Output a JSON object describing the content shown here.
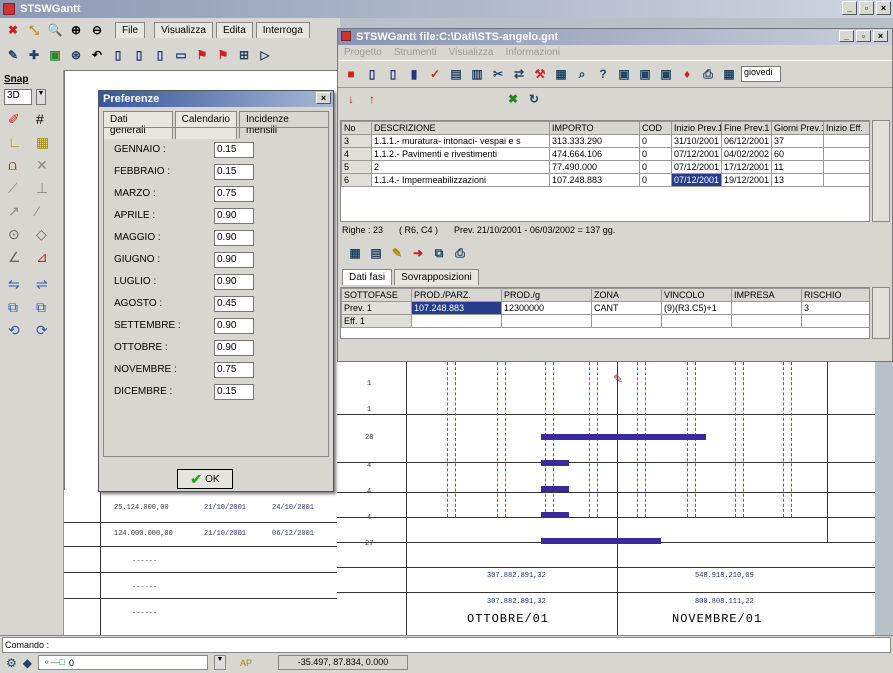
{
  "main_window": {
    "title": "STSWGantt"
  },
  "left_menu": {
    "file": "File",
    "visualizza": "Visualizza",
    "edita": "Edita",
    "interroga": "Interroga"
  },
  "snap": {
    "label": "Snap",
    "dim": "3D"
  },
  "preferences": {
    "title": "Preferenze",
    "tabs": [
      "Dati generali",
      "Calendario",
      "Incidenze mensili"
    ],
    "months": [
      {
        "name": "GENNAIO :",
        "value": "0.15"
      },
      {
        "name": "FEBBRAIO :",
        "value": "0.15"
      },
      {
        "name": "MARZO :",
        "value": "0.75"
      },
      {
        "name": "APRILE :",
        "value": "0.90"
      },
      {
        "name": "MAGGIO :",
        "value": "0.90"
      },
      {
        "name": "GIUGNO :",
        "value": "0.90"
      },
      {
        "name": "LUGLIO :",
        "value": "0.90"
      },
      {
        "name": "AGOSTO :",
        "value": "0.45"
      },
      {
        "name": "SETTEMBRE :",
        "value": "0.90"
      },
      {
        "name": "OTTOBRE :",
        "value": "0.90"
      },
      {
        "name": "NOVEMBRE :",
        "value": "0.75"
      },
      {
        "name": "DICEMBRE :",
        "value": "0.15"
      }
    ],
    "ok_label": "OK"
  },
  "inner_window": {
    "title": "STSWGantt      file:C:\\Dati\\STS-angelo.gnt",
    "menu": [
      "Progetto",
      "Strumenti",
      "Visualizza",
      "Informazioni"
    ],
    "day_field": "giovedi",
    "table_headers": [
      "No",
      "DESCRIZIONE",
      "IMPORTO",
      "COD",
      "Inizio Prev.1",
      "Fine Prev.1",
      "Giorni Prev.1",
      "Inizio Eff."
    ],
    "rows": [
      [
        "3",
        "1.1.1.- muratura- intonaci- vespai e s",
        "313.333.290",
        "0",
        "31/10/2001",
        "06/12/2001",
        "37",
        ""
      ],
      [
        "4",
        "1.1.2.- Pavimenti e rivestimenti",
        "474.664.106",
        "0",
        "07/12/2001",
        "04/02/2002",
        "60",
        ""
      ],
      [
        "5",
        "2",
        "77.490.000",
        "0",
        "07/12/2001",
        "17/12/2001",
        "11",
        ""
      ],
      [
        "6",
        "1.1.4.- Impermeabilizzazioni",
        "107.248.883",
        "0",
        "07/12/2001",
        "19/12/2001",
        "13",
        ""
      ]
    ],
    "status": {
      "righe": "Righe : 23",
      "rc": "( R6, C4 )",
      "prev": "Prev. 21/10/2001 - 06/03/2002 = 137 gg."
    },
    "sub_tabs": [
      "Dati fasi",
      "Sovrapposizioni"
    ],
    "sub_headers": [
      "SOTTOFASE",
      "PROD./PARZ.",
      "PROD./g",
      "ZONA",
      "VINCOLO",
      "IMPRESA",
      "RISCHIO"
    ],
    "sub_rows": [
      [
        "Prev. 1",
        "107.248.883",
        "12300000",
        "CANT",
        "(9)(R3.C5)+1",
        "",
        "3"
      ],
      [
        "Eff. 1",
        "",
        "",
        "",
        "",
        "",
        ""
      ]
    ]
  },
  "gantt": {
    "row_labels": [
      "1",
      "1",
      "28",
      "4",
      "4",
      "4",
      "27"
    ],
    "left_values": [
      {
        "amount": "25.124.000,00",
        "d1": "21/10/2001",
        "d2": "24/10/2001"
      },
      {
        "amount": "124.000.000,00",
        "d1": "21/10/2001",
        "d2": "06/12/2001"
      }
    ],
    "dashes": [
      "------",
      "------",
      "------"
    ],
    "totals_oct": [
      "307.882.891,32",
      "307.882.891,32"
    ],
    "totals_nov": [
      "548.918.210,09",
      "800.808.111,22"
    ],
    "months": [
      "OTTOBRE/01",
      "NOVEMBRE/01"
    ]
  },
  "command": {
    "label": "Comando :",
    "coords": "-35.497, 87.834, 0.000",
    "layer": "0",
    "ap": "AP"
  }
}
